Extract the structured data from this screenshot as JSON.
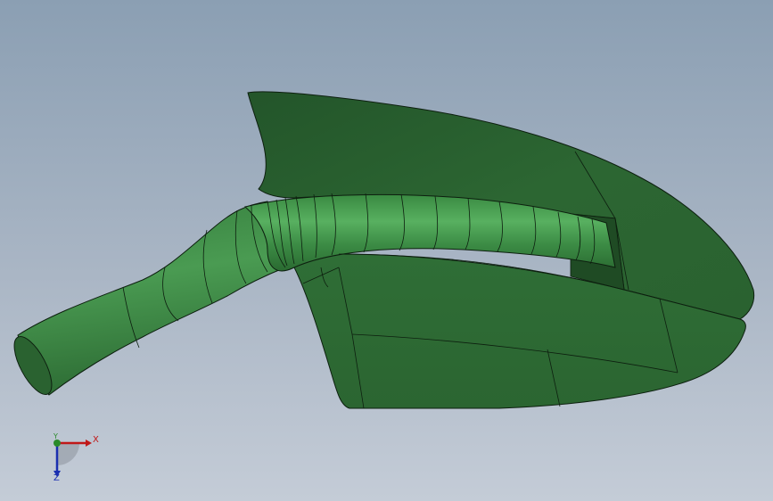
{
  "viewport": {
    "background_top": "#8b9fb3",
    "background_bottom": "#c4ccd7"
  },
  "model": {
    "part_color": "#2e6d35",
    "edge_color": "#0d1f0f",
    "shaft_highlight": "#4ea055"
  },
  "triad": {
    "x_label": "X",
    "y_label": "Y",
    "z_label": "Z",
    "x_color": "#c01818",
    "y_color": "#2a8a2a",
    "z_color": "#1a2fb0"
  }
}
